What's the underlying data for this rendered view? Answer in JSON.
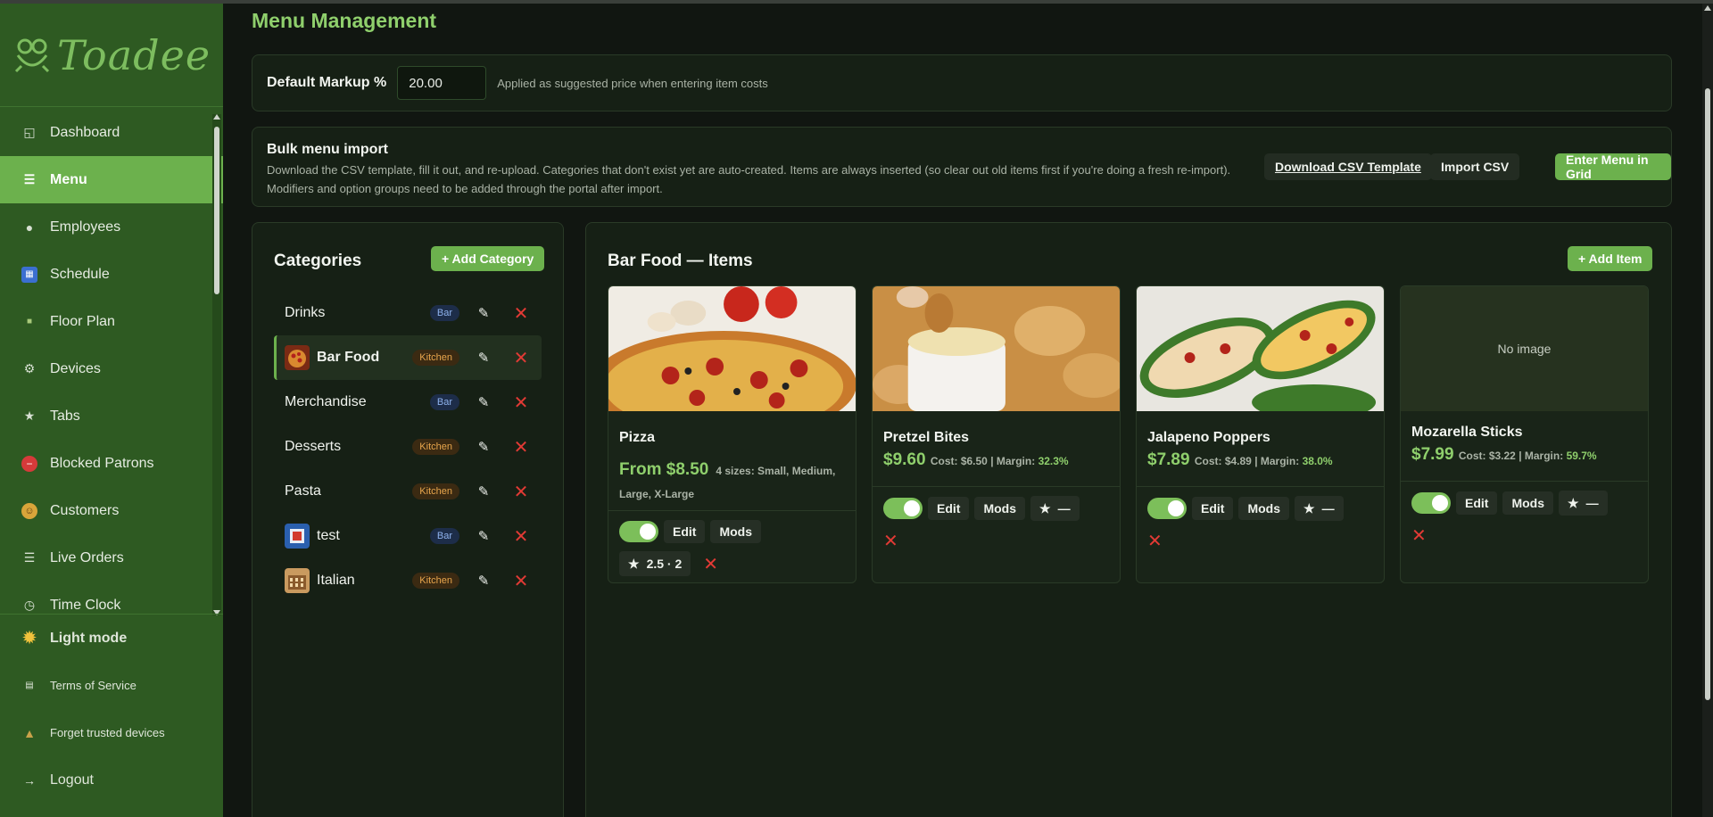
{
  "app": {
    "logo_text": "Toadee"
  },
  "sidebar": {
    "items": [
      {
        "label": "Dashboard",
        "icon": "dashboard-icon"
      },
      {
        "label": "Menu",
        "icon": "menu-icon",
        "active": true
      },
      {
        "label": "Employees",
        "icon": "person-icon"
      },
      {
        "label": "Schedule",
        "icon": "calendar-icon"
      },
      {
        "label": "Floor Plan",
        "icon": "floor-plan-icon"
      },
      {
        "label": "Devices",
        "icon": "gear-icon"
      },
      {
        "label": "Tabs",
        "icon": "star-icon"
      },
      {
        "label": "Blocked Patrons",
        "icon": "no-entry-icon"
      },
      {
        "label": "Customers",
        "icon": "face-icon"
      },
      {
        "label": "Live Orders",
        "icon": "list-icon"
      },
      {
        "label": "Time Clock",
        "icon": "clock-icon"
      }
    ],
    "bottom": {
      "light_mode": "Light mode",
      "terms": "Terms of Service",
      "forget": "Forget trusted devices",
      "logout": "Logout"
    }
  },
  "page": {
    "title": "Menu Management"
  },
  "markup": {
    "label": "Default Markup %",
    "value": "20.00",
    "hint": "Applied as suggested price when entering item costs"
  },
  "bulk": {
    "title": "Bulk menu import",
    "description": "Download the CSV template, fill it out, and re-upload. Categories that don't exist yet are auto-created. Items are always inserted (so clear out old items first if you're doing a fresh re-import). Modifiers and option groups need to be added through the portal after import.",
    "download": "Download CSV Template",
    "import": "Import CSV",
    "grid": "Enter Menu in Grid"
  },
  "categories": {
    "title": "Categories",
    "add": "+ Add Category",
    "list": [
      {
        "name": "Drinks",
        "badge": "Bar"
      },
      {
        "name": "Bar Food",
        "badge": "Kitchen",
        "active": true
      },
      {
        "name": "Merchandise",
        "badge": "Bar"
      },
      {
        "name": "Desserts",
        "badge": "Kitchen"
      },
      {
        "name": "Pasta",
        "badge": "Kitchen"
      },
      {
        "name": "test",
        "badge": "Bar"
      },
      {
        "name": "Italian",
        "badge": "Kitchen"
      }
    ]
  },
  "items_panel": {
    "title": "Bar Food — Items",
    "add": "+ Add Item",
    "cards": [
      {
        "name": "Pizza",
        "price": "From $8.50",
        "sizes": "4 sizes: Small, Medium, Large, X-Large",
        "edit": "Edit",
        "mods": "Mods",
        "rating": "2.5 · 2",
        "enabled": true
      },
      {
        "name": "Pretzel Bites",
        "price": "$9.60",
        "cost": "Cost: $6.50 | Margin:",
        "margin": "32.3%",
        "edit": "Edit",
        "mods": "Mods",
        "rating": "—",
        "enabled": true
      },
      {
        "name": "Jalapeno Poppers",
        "price": "$7.89",
        "cost": "Cost: $4.89 | Margin:",
        "margin": "38.0%",
        "edit": "Edit",
        "mods": "Mods",
        "rating": "—",
        "enabled": true
      },
      {
        "name": "Mozarella Sticks",
        "price": "$7.99",
        "cost": "Cost: $3.22 | Margin:",
        "margin": "59.7%",
        "edit": "Edit",
        "mods": "Mods",
        "rating": "—",
        "no_image": "No image",
        "enabled": true
      }
    ]
  }
}
